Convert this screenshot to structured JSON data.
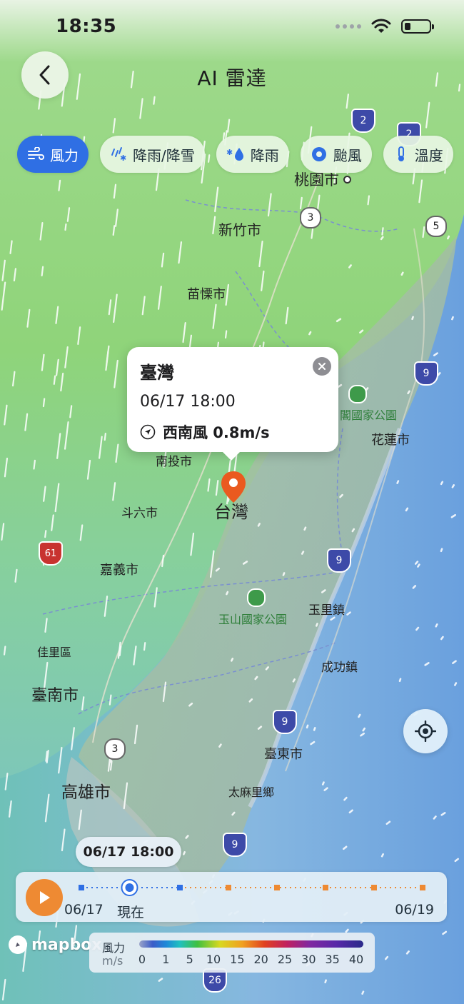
{
  "status_bar": {
    "time": "18:35"
  },
  "header": {
    "title": "AI 雷達"
  },
  "layer_chips": [
    {
      "label": "風力",
      "icon": "wind-icon",
      "active": true
    },
    {
      "label": "降雨/降雪",
      "icon": "rain-snow-icon",
      "active": false
    },
    {
      "label": "降雨",
      "icon": "rain-icon",
      "active": false
    },
    {
      "label": "颱風",
      "icon": "typhoon-icon",
      "active": false
    },
    {
      "label": "溫度",
      "icon": "thermometer-icon",
      "active": false
    }
  ],
  "map": {
    "cities": [
      {
        "name": "桃園市"
      },
      {
        "name": "新竹市"
      },
      {
        "name": "苗慄市"
      },
      {
        "name": "南投市"
      },
      {
        "name": "斗六市"
      },
      {
        "name": "台灣"
      },
      {
        "name": "嘉義市"
      },
      {
        "name": "佳里區"
      },
      {
        "name": "臺南市"
      },
      {
        "name": "高雄市"
      },
      {
        "name": "花蓮市"
      },
      {
        "name": "玉里鎮"
      },
      {
        "name": "成功鎮"
      },
      {
        "name": "臺東市"
      },
      {
        "name": "太麻里鄉"
      }
    ],
    "parks": [
      {
        "name": "閣國家公園"
      },
      {
        "name": "玉山國家公園"
      }
    ],
    "road_shields": [
      {
        "number": "2",
        "type": "national"
      },
      {
        "number": "2",
        "type": "national"
      },
      {
        "number": "3",
        "type": "flower"
      },
      {
        "number": "5",
        "type": "flower"
      },
      {
        "number": "9",
        "type": "national"
      },
      {
        "number": "61",
        "type": "expressway"
      },
      {
        "number": "9",
        "type": "national"
      },
      {
        "number": "9",
        "type": "national"
      },
      {
        "number": "3",
        "type": "flower"
      },
      {
        "number": "9",
        "type": "national"
      },
      {
        "number": "26",
        "type": "national"
      }
    ]
  },
  "popup": {
    "title": "臺灣",
    "datetime": "06/17 18:00",
    "wind": "西南風 0.8m/s"
  },
  "timeline": {
    "current_time": "06/17 18:00",
    "start_label": "06/17",
    "now_label": "現在",
    "end_label": "06/19",
    "progress": 0.14
  },
  "legend": {
    "label": "風力",
    "unit": "m/s",
    "ticks": [
      "0",
      "1",
      "5",
      "10",
      "15",
      "20",
      "25",
      "30",
      "35",
      "40"
    ]
  },
  "attribution": {
    "text": "mapbox"
  },
  "colors": {
    "accent": "#2f6fe4",
    "play": "#ee8a33",
    "marker": "#ea5a1f",
    "land_green": "#8fd47a",
    "sea_blue": "#7cb3e6"
  }
}
